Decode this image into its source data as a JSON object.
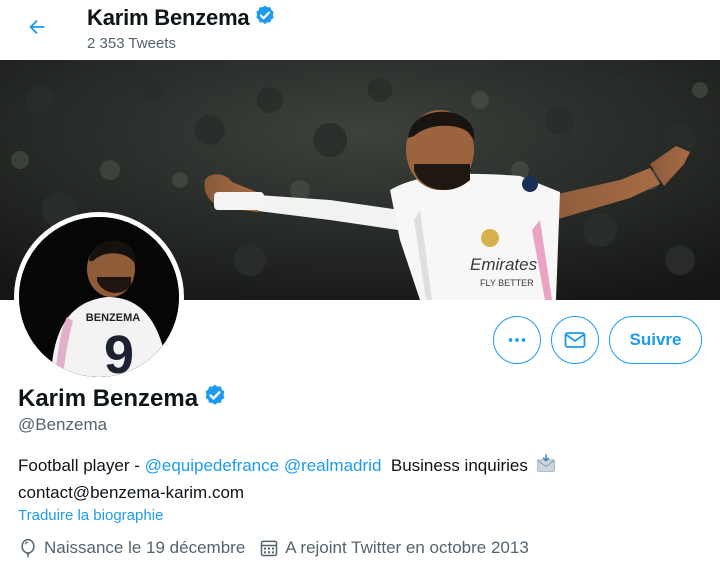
{
  "header": {
    "name": "Karim Benzema",
    "tweet_count": "2 353 Tweets"
  },
  "profile": {
    "name": "Karim Benzema",
    "handle": "@Benzema",
    "bio": {
      "prefix": "Football player - ",
      "mention_1": "@equipedefrance",
      "mention_2": "@realmadrid",
      "text_after": "Business inquiries",
      "email": "contact@benzema-karim.com"
    },
    "translate_label": "Traduire la biographie",
    "birthday": "Naissance le 19 décembre",
    "joined": "A rejoint Twitter en octobre 2013"
  },
  "avatar_jersey": {
    "name_on_back": "BENZEMA",
    "number": "9"
  },
  "banner_jersey": {
    "sponsor_line1": "Emirates",
    "sponsor_line2": "FLY BETTER"
  },
  "buttons": {
    "more_icon": "more-icon",
    "message_icon": "mail-icon",
    "follow_label": "Suivre"
  },
  "colors": {
    "accent": "#1d9bf0",
    "secondary_text": "#536471",
    "primary_text": "#0f1419"
  }
}
